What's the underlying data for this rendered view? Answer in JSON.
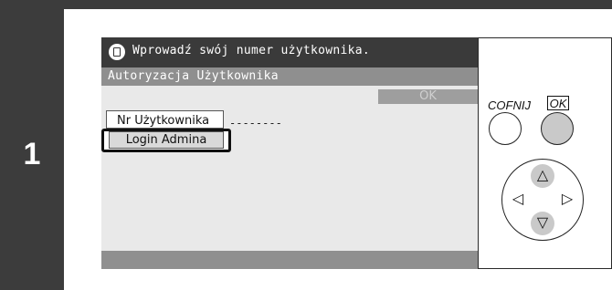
{
  "step": {
    "number": "1"
  },
  "screen": {
    "message": "Wprowadź swój numer użytkownika.",
    "title": "Autoryzacja Użytkownika",
    "ok_button": "OK",
    "user_number_button": "Nr Użytkownika",
    "user_number_value": "--------",
    "admin_login_button": "Login Admina",
    "icons": {
      "message": "document-icon"
    }
  },
  "controls": {
    "back_label": "COFNIJ",
    "ok_label": "OK",
    "dpad": {
      "up": "△",
      "down": "▽",
      "left": "◁",
      "right": "▷"
    }
  },
  "colors": {
    "dark_bar": "#3a3a3a",
    "title_bar": "#8f8f8f",
    "screen_bg": "#e9e9e9",
    "pressed_key": "#c9c9c9"
  }
}
